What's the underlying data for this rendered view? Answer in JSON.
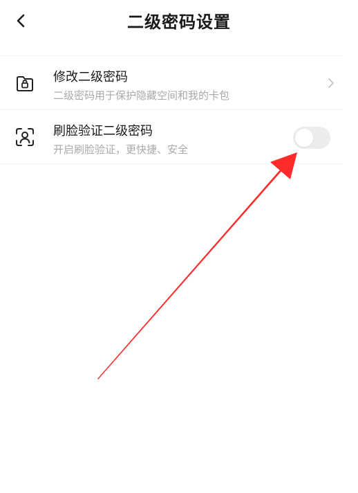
{
  "header": {
    "title": "二级密码设置",
    "back_icon": "chevron-left-icon"
  },
  "items": [
    {
      "icon": "folder-lock-icon",
      "title": "修改二级密码",
      "subtitle": "二级密码用于保护隐藏空间和我的卡包",
      "trailing": "chevron-right-icon"
    },
    {
      "icon": "face-scan-icon",
      "title": "刷脸验证二级密码",
      "subtitle": "开启刷脸验证，更快捷、安全",
      "toggle_on": false
    }
  ],
  "colors": {
    "annotation_arrow": "#ff2a2a",
    "toggle_off": "#ececec",
    "subtitle": "#a9a9a9"
  }
}
